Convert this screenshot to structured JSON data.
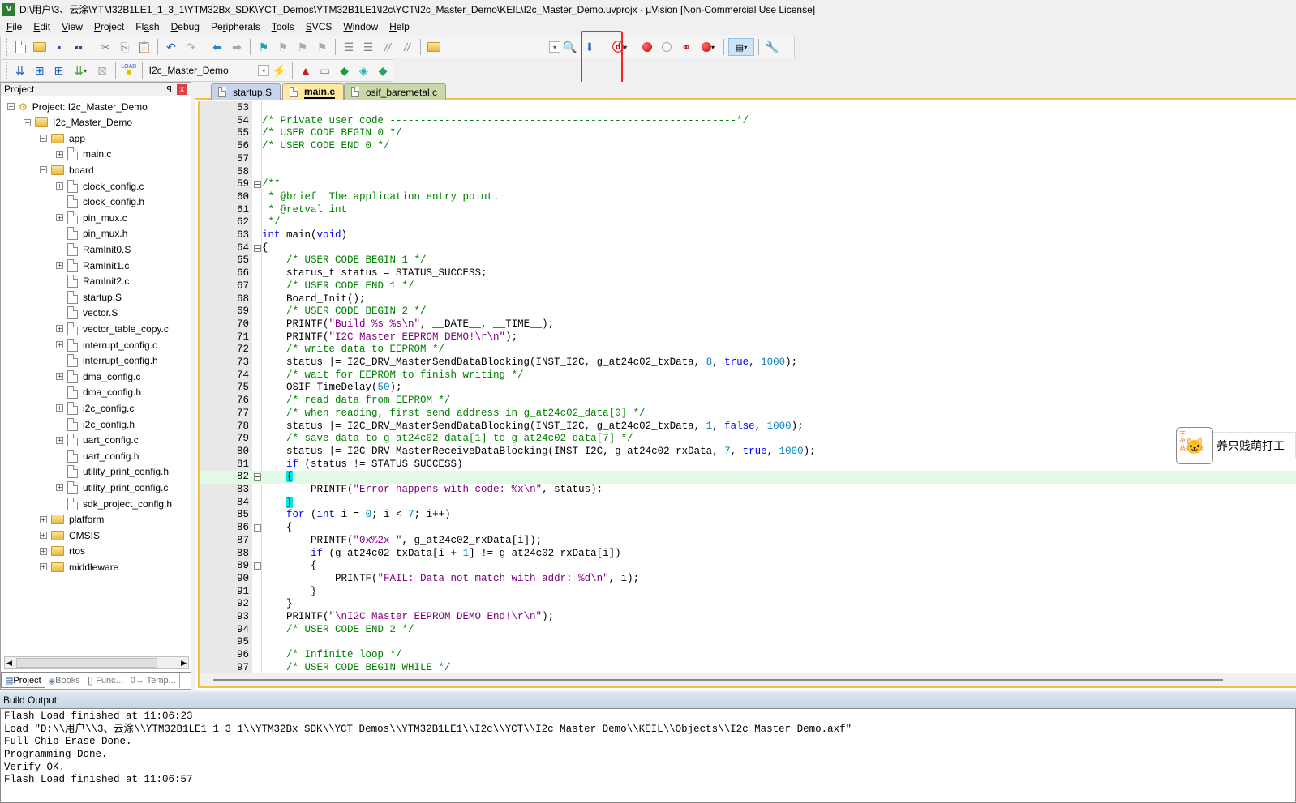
{
  "window": {
    "title": "D:\\用户\\3、云涂\\YTM32B1LE1_1_3_1\\YTM32Bx_SDK\\YCT_Demos\\YTM32B1LE1\\I2c\\YCT\\I2c_Master_Demo\\KEIL\\I2c_Master_Demo.uvprojx - µVision  [Non-Commercial Use License]",
    "app_icon": "V"
  },
  "menu": [
    {
      "label": "File",
      "key": "F"
    },
    {
      "label": "Edit",
      "key": "E"
    },
    {
      "label": "View",
      "key": "V"
    },
    {
      "label": "Project",
      "key": "P"
    },
    {
      "label": "Flash",
      "key": "a"
    },
    {
      "label": "Debug",
      "key": "D"
    },
    {
      "label": "Peripherals",
      "key": "r"
    },
    {
      "label": "Tools",
      "key": "T"
    },
    {
      "label": "SVCS",
      "key": "S"
    },
    {
      "label": "Window",
      "key": "W"
    },
    {
      "label": "Help",
      "key": "H"
    }
  ],
  "toolbar2": {
    "target_select": "I2c_Master_Demo",
    "load_label": "LOAD"
  },
  "project_panel": {
    "title": "Project",
    "pin_glyph": "ꟼ",
    "close_glyph": "x",
    "tree": [
      {
        "label": "Project: I2c_Master_Demo",
        "icon": "project-icon",
        "level": 0,
        "expander": "-"
      },
      {
        "label": "I2c_Master_Demo",
        "icon": "target-folder-icon",
        "level": 1,
        "expander": "-"
      },
      {
        "label": "app",
        "icon": "folder-open-icon",
        "level": 2,
        "expander": "-"
      },
      {
        "label": "main.c",
        "icon": "file-icon",
        "level": 3,
        "expander": "+"
      },
      {
        "label": "board",
        "icon": "folder-open-icon",
        "level": 2,
        "expander": "-"
      },
      {
        "label": "clock_config.c",
        "icon": "file-icon",
        "level": 3,
        "expander": "+"
      },
      {
        "label": "clock_config.h",
        "icon": "file-icon",
        "level": 3,
        "expander": ""
      },
      {
        "label": "pin_mux.c",
        "icon": "file-icon",
        "level": 3,
        "expander": "+"
      },
      {
        "label": "pin_mux.h",
        "icon": "file-icon",
        "level": 3,
        "expander": ""
      },
      {
        "label": "RamInit0.S",
        "icon": "file-icon",
        "level": 3,
        "expander": ""
      },
      {
        "label": "RamInit1.c",
        "icon": "file-icon",
        "level": 3,
        "expander": "+"
      },
      {
        "label": "RamInit2.c",
        "icon": "file-icon",
        "level": 3,
        "expander": ""
      },
      {
        "label": "startup.S",
        "icon": "file-icon",
        "level": 3,
        "expander": ""
      },
      {
        "label": "vector.S",
        "icon": "file-icon",
        "level": 3,
        "expander": ""
      },
      {
        "label": "vector_table_copy.c",
        "icon": "file-icon",
        "level": 3,
        "expander": "+"
      },
      {
        "label": "interrupt_config.c",
        "icon": "file-icon",
        "level": 3,
        "expander": "+"
      },
      {
        "label": "interrupt_config.h",
        "icon": "file-icon",
        "level": 3,
        "expander": ""
      },
      {
        "label": "dma_config.c",
        "icon": "file-icon",
        "level": 3,
        "expander": "+"
      },
      {
        "label": "dma_config.h",
        "icon": "file-icon",
        "level": 3,
        "expander": ""
      },
      {
        "label": "i2c_config.c",
        "icon": "file-icon",
        "level": 3,
        "expander": "+"
      },
      {
        "label": "i2c_config.h",
        "icon": "file-icon",
        "level": 3,
        "expander": ""
      },
      {
        "label": "uart_config.c",
        "icon": "file-icon",
        "level": 3,
        "expander": "+"
      },
      {
        "label": "uart_config.h",
        "icon": "file-icon",
        "level": 3,
        "expander": ""
      },
      {
        "label": "utility_print_config.h",
        "icon": "file-icon",
        "level": 3,
        "expander": ""
      },
      {
        "label": "utility_print_config.c",
        "icon": "file-icon",
        "level": 3,
        "expander": "+"
      },
      {
        "label": "sdk_project_config.h",
        "icon": "file-icon",
        "level": 3,
        "expander": ""
      },
      {
        "label": "platform",
        "icon": "folder-icon",
        "level": 2,
        "expander": "+"
      },
      {
        "label": "CMSIS",
        "icon": "folder-icon",
        "level": 2,
        "expander": "+"
      },
      {
        "label": "rtos",
        "icon": "folder-icon",
        "level": 2,
        "expander": "+"
      },
      {
        "label": "middleware",
        "icon": "folder-icon",
        "level": 2,
        "expander": "+"
      }
    ],
    "tabs": [
      {
        "label": "Project",
        "active": true
      },
      {
        "label": "Books",
        "active": false
      },
      {
        "label": "{} Func...",
        "active": false
      },
      {
        "label": "0→ Temp...",
        "active": false
      }
    ]
  },
  "editor": {
    "tabs": [
      {
        "label": "startup.S",
        "active": false,
        "color": "#c8d4ec"
      },
      {
        "label": "main.c",
        "active": true,
        "color": "#fde9a0"
      },
      {
        "label": "osif_baremetal.c",
        "active": false,
        "color": "#c8d8a8"
      }
    ],
    "current_line": 82,
    "lines": [
      {
        "n": 53,
        "fold": "",
        "segs": []
      },
      {
        "n": 54,
        "fold": "",
        "segs": [
          [
            "cm",
            "/* Private user code ---------------------------------------------------------*/"
          ]
        ]
      },
      {
        "n": 55,
        "fold": "",
        "segs": [
          [
            "cm",
            "/* USER CODE BEGIN 0 */"
          ]
        ]
      },
      {
        "n": 56,
        "fold": "",
        "segs": [
          [
            "cm",
            "/* USER CODE END 0 */"
          ]
        ]
      },
      {
        "n": 57,
        "fold": "",
        "segs": []
      },
      {
        "n": 58,
        "fold": "",
        "segs": []
      },
      {
        "n": 59,
        "fold": "-",
        "segs": [
          [
            "cm",
            "/**"
          ]
        ]
      },
      {
        "n": 60,
        "fold": "",
        "segs": [
          [
            "cm",
            " * @brief  The application entry point."
          ]
        ]
      },
      {
        "n": 61,
        "fold": "",
        "segs": [
          [
            "cm",
            " * @retval int"
          ]
        ]
      },
      {
        "n": 62,
        "fold": "",
        "segs": [
          [
            "cm",
            " */"
          ]
        ]
      },
      {
        "n": 63,
        "fold": "",
        "segs": [
          [
            "kw",
            "int"
          ],
          [
            "pl",
            " main("
          ],
          [
            "kw",
            "void"
          ],
          [
            "pl",
            ")"
          ]
        ]
      },
      {
        "n": 64,
        "fold": "-",
        "segs": [
          [
            "pl",
            "{"
          ]
        ]
      },
      {
        "n": 65,
        "fold": "",
        "segs": [
          [
            "pl",
            "    "
          ],
          [
            "cm",
            "/* USER CODE BEGIN 1 */"
          ]
        ]
      },
      {
        "n": 66,
        "fold": "",
        "segs": [
          [
            "pl",
            "    status_t status = STATUS_SUCCESS;"
          ]
        ]
      },
      {
        "n": 67,
        "fold": "",
        "segs": [
          [
            "pl",
            "    "
          ],
          [
            "cm",
            "/* USER CODE END 1 */"
          ]
        ]
      },
      {
        "n": 68,
        "fold": "",
        "segs": [
          [
            "pl",
            "    Board_Init();"
          ]
        ]
      },
      {
        "n": 69,
        "fold": "",
        "segs": [
          [
            "pl",
            "    "
          ],
          [
            "cm",
            "/* USER CODE BEGIN 2 */"
          ]
        ]
      },
      {
        "n": 70,
        "fold": "",
        "segs": [
          [
            "pl",
            "    PRINTF("
          ],
          [
            "st",
            "\"Build %s %s\\n\""
          ],
          [
            "pl",
            ", __DATE__, __TIME__);"
          ]
        ]
      },
      {
        "n": 71,
        "fold": "",
        "segs": [
          [
            "pl",
            "    PRINTF("
          ],
          [
            "st",
            "\"I2C Master EEPROM DEMO!\\r\\n\""
          ],
          [
            "pl",
            ");"
          ]
        ]
      },
      {
        "n": 72,
        "fold": "",
        "segs": [
          [
            "pl",
            "    "
          ],
          [
            "cm",
            "/* write data to EEPROM */"
          ]
        ]
      },
      {
        "n": 73,
        "fold": "",
        "segs": [
          [
            "pl",
            "    status |= I2C_DRV_MasterSendDataBlocking(INST_I2C, g_at24c02_txData, "
          ],
          [
            "nm",
            "8"
          ],
          [
            "pl",
            ", "
          ],
          [
            "kw",
            "true"
          ],
          [
            "pl",
            ", "
          ],
          [
            "nm",
            "1000"
          ],
          [
            "pl",
            ");"
          ]
        ]
      },
      {
        "n": 74,
        "fold": "",
        "segs": [
          [
            "pl",
            "    "
          ],
          [
            "cm",
            "/* wait for EEPROM to finish writing */"
          ]
        ]
      },
      {
        "n": 75,
        "fold": "",
        "segs": [
          [
            "pl",
            "    OSIF_TimeDelay("
          ],
          [
            "nm",
            "50"
          ],
          [
            "pl",
            ");"
          ]
        ]
      },
      {
        "n": 76,
        "fold": "",
        "segs": [
          [
            "pl",
            "    "
          ],
          [
            "cm",
            "/* read data from EEPROM */"
          ]
        ]
      },
      {
        "n": 77,
        "fold": "",
        "segs": [
          [
            "pl",
            "    "
          ],
          [
            "cm",
            "/* when reading, first send address in g_at24c02_data[0] */"
          ]
        ]
      },
      {
        "n": 78,
        "fold": "",
        "segs": [
          [
            "pl",
            "    status |= I2C_DRV_MasterSendDataBlocking(INST_I2C, g_at24c02_txData, "
          ],
          [
            "nm",
            "1"
          ],
          [
            "pl",
            ", "
          ],
          [
            "kw",
            "false"
          ],
          [
            "pl",
            ", "
          ],
          [
            "nm",
            "1000"
          ],
          [
            "pl",
            ");"
          ]
        ]
      },
      {
        "n": 79,
        "fold": "",
        "segs": [
          [
            "pl",
            "    "
          ],
          [
            "cm",
            "/* save data to g_at24c02_data[1] to g_at24c02_data[7] */"
          ]
        ]
      },
      {
        "n": 80,
        "fold": "",
        "segs": [
          [
            "pl",
            "    status |= I2C_DRV_MasterReceiveDataBlocking(INST_I2C, g_at24c02_rxData, "
          ],
          [
            "nm",
            "7"
          ],
          [
            "pl",
            ", "
          ],
          [
            "kw",
            "true"
          ],
          [
            "pl",
            ", "
          ],
          [
            "nm",
            "1000"
          ],
          [
            "pl",
            ");"
          ]
        ]
      },
      {
        "n": 81,
        "fold": "",
        "segs": [
          [
            "pl",
            "    "
          ],
          [
            "kw",
            "if"
          ],
          [
            "pl",
            " (status != STATUS_SUCCESS)"
          ]
        ]
      },
      {
        "n": 82,
        "fold": "-",
        "segs": [
          [
            "pl",
            "    "
          ],
          [
            "br",
            "{"
          ]
        ]
      },
      {
        "n": 83,
        "fold": "",
        "segs": [
          [
            "pl",
            "        PRINTF("
          ],
          [
            "st",
            "\"Error happens with code: %x\\n\""
          ],
          [
            "pl",
            ", status);"
          ]
        ]
      },
      {
        "n": 84,
        "fold": "",
        "segs": [
          [
            "pl",
            "    "
          ],
          [
            "br",
            "}"
          ]
        ]
      },
      {
        "n": 85,
        "fold": "",
        "segs": [
          [
            "pl",
            "    "
          ],
          [
            "kw",
            "for"
          ],
          [
            "pl",
            " ("
          ],
          [
            "kw",
            "int"
          ],
          [
            "pl",
            " i = "
          ],
          [
            "nm",
            "0"
          ],
          [
            "pl",
            "; i < "
          ],
          [
            "nm",
            "7"
          ],
          [
            "pl",
            "; i++)"
          ]
        ]
      },
      {
        "n": 86,
        "fold": "-",
        "segs": [
          [
            "pl",
            "    {"
          ]
        ]
      },
      {
        "n": 87,
        "fold": "",
        "segs": [
          [
            "pl",
            "        PRINTF("
          ],
          [
            "st",
            "\"0x%2x \""
          ],
          [
            "pl",
            ", g_at24c02_rxData[i]);"
          ]
        ]
      },
      {
        "n": 88,
        "fold": "",
        "segs": [
          [
            "pl",
            "        "
          ],
          [
            "kw",
            "if"
          ],
          [
            "pl",
            " (g_at24c02_txData[i + "
          ],
          [
            "nm",
            "1"
          ],
          [
            "pl",
            "] != g_at24c02_rxData[i])"
          ]
        ]
      },
      {
        "n": 89,
        "fold": "-",
        "segs": [
          [
            "pl",
            "        {"
          ]
        ]
      },
      {
        "n": 90,
        "fold": "",
        "segs": [
          [
            "pl",
            "            PRINTF("
          ],
          [
            "st",
            "\"FAIL: Data not match with addr: %d\\n\""
          ],
          [
            "pl",
            ", i);"
          ]
        ]
      },
      {
        "n": 91,
        "fold": "",
        "segs": [
          [
            "pl",
            "        }"
          ]
        ]
      },
      {
        "n": 92,
        "fold": "",
        "segs": [
          [
            "pl",
            "    }"
          ]
        ]
      },
      {
        "n": 93,
        "fold": "",
        "segs": [
          [
            "pl",
            "    PRINTF("
          ],
          [
            "st",
            "\"\\nI2C Master EEPROM DEMO End!\\r\\n\""
          ],
          [
            "pl",
            ");"
          ]
        ]
      },
      {
        "n": 94,
        "fold": "",
        "segs": [
          [
            "pl",
            "    "
          ],
          [
            "cm",
            "/* USER CODE END 2 */"
          ]
        ]
      },
      {
        "n": 95,
        "fold": "",
        "segs": []
      },
      {
        "n": 96,
        "fold": "",
        "segs": [
          [
            "pl",
            "    "
          ],
          [
            "cm",
            "/* Infinite loop */"
          ]
        ]
      },
      {
        "n": 97,
        "fold": "",
        "segs": [
          [
            "pl",
            "    "
          ],
          [
            "cm",
            "/* USER CODE BEGIN WHILE */"
          ]
        ]
      }
    ]
  },
  "build_output": {
    "title": "Build Output",
    "lines": [
      "Flash Load finished at 11:06:23",
      "Load \"D:\\\\用户\\\\3、云涂\\\\YTM32B1LE1_1_3_1\\\\YTM32Bx_SDK\\\\YCT_Demos\\\\YTM32B1LE1\\\\I2c\\\\YCT\\\\I2c_Master_Demo\\\\KEIL\\\\Objects\\\\I2c_Master_Demo.axf\"",
      "Full Chip Erase Done.",
      "Programming Done.",
      "Verify OK.",
      "Flash Load finished at 11:06:57"
    ]
  },
  "floating_widget": {
    "text": "养只贱萌打工",
    "badge": "不孕苔"
  },
  "annotation": {
    "color": "#ff2020",
    "target": "start-stop-debug-session-button"
  }
}
